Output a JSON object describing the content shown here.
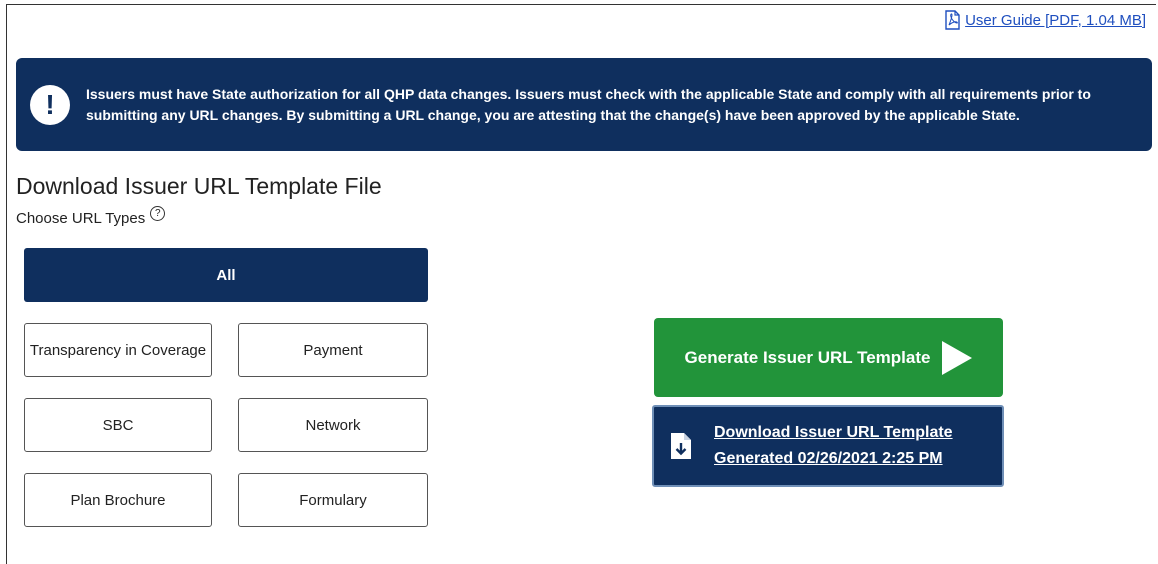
{
  "header": {
    "user_guide_link": "User Guide [PDF, 1.04 MB]",
    "user_guide_icon": "pdf-icon"
  },
  "alert": {
    "icon": "exclamation-icon",
    "message": "Issuers must have State authorization for all QHP data changes. Issuers must check with the applicable State and comply with all requirements prior to submitting any URL changes. By submitting a URL change, you are attesting that the change(s) have been approved by the applicable State."
  },
  "section": {
    "title": "Download Issuer URL Template File",
    "choose_label": "Choose URL Types",
    "help_icon": "question-circle-icon"
  },
  "url_types": {
    "all": "All",
    "items": [
      {
        "label": "Transparency in Coverage"
      },
      {
        "label": "Payment"
      },
      {
        "label": "SBC"
      },
      {
        "label": "Network"
      },
      {
        "label": "Plan Brochure"
      },
      {
        "label": "Formulary"
      }
    ]
  },
  "actions": {
    "generate_label": "Generate Issuer URL Template",
    "generate_icon": "play-icon",
    "download_line1": "Download Issuer URL Template",
    "download_line2": "Generated 02/26/2021 2:25 PM",
    "download_icon": "file-download-icon"
  },
  "colors": {
    "navy": "#0f2f5e",
    "green": "#22943a",
    "link": "#1f4fbf"
  }
}
